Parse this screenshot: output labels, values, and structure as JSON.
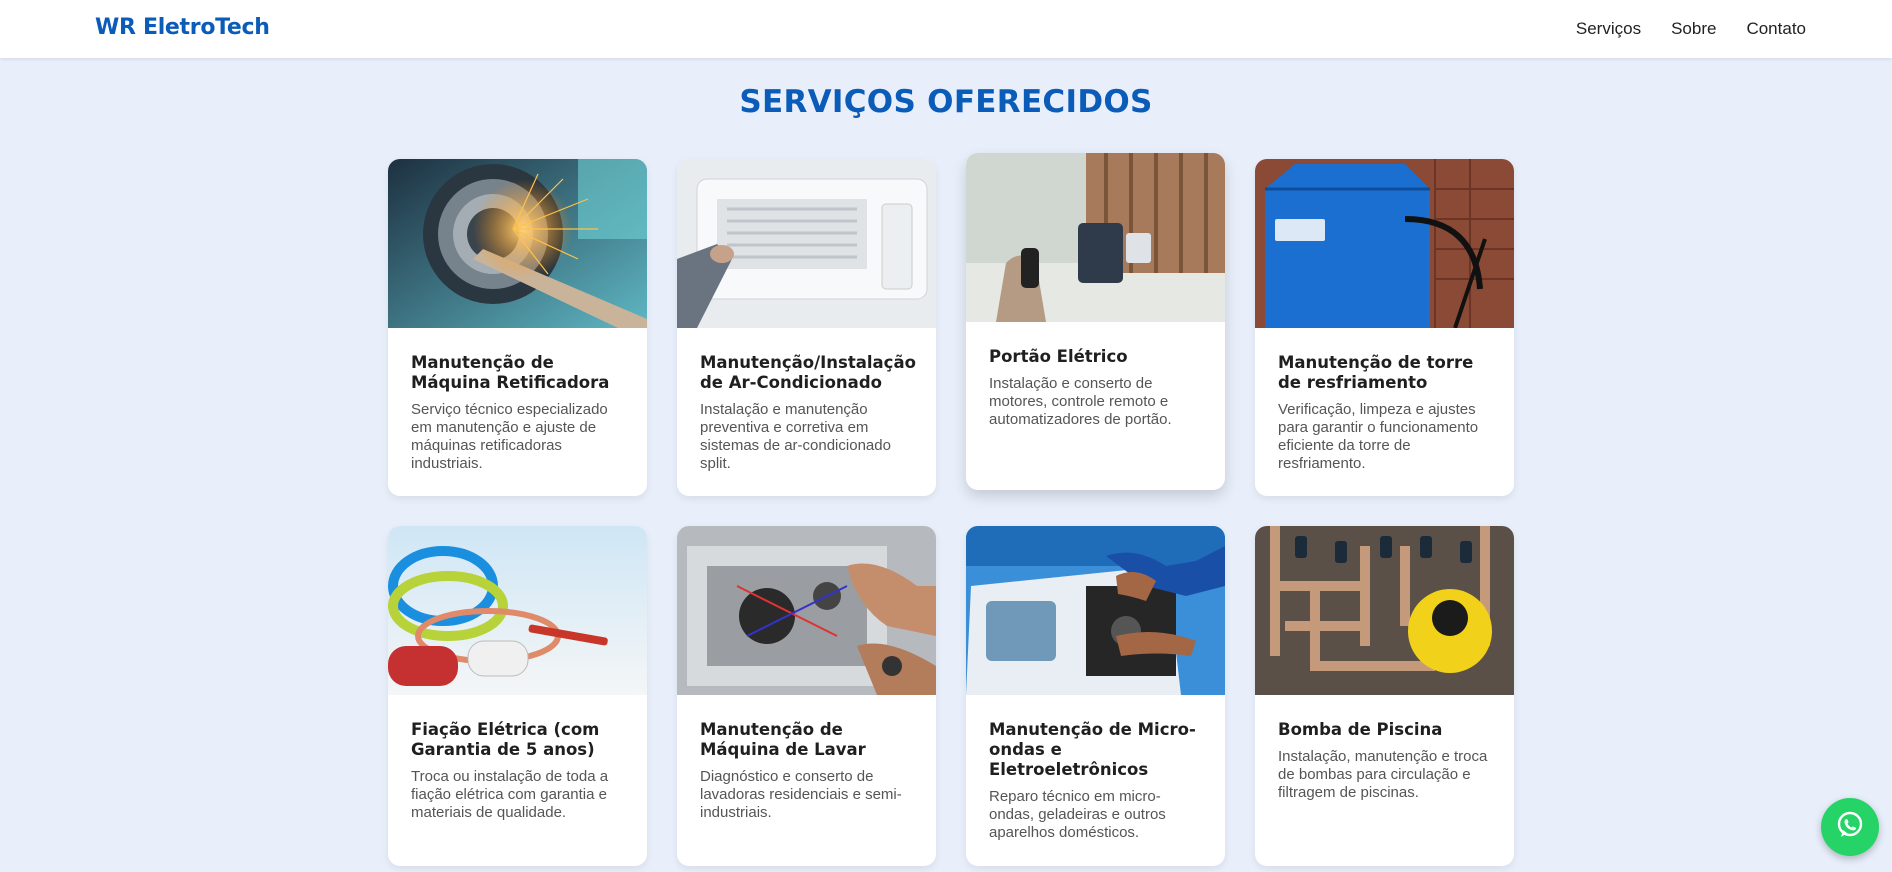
{
  "nav": {
    "logo": "WR EletroTech",
    "links": [
      "Serviços",
      "Sobre",
      "Contato"
    ]
  },
  "section": {
    "title": "SERVIÇOS OFERECIDOS"
  },
  "services": [
    {
      "title": "Manutenção de Máquina Retificadora",
      "description": "Serviço técnico especializado em manutenção e ajuste de máquinas retificadoras industriais."
    },
    {
      "title": "Manutenção/Instalação de Ar-Condicionado",
      "description": "Instalação e manutenção preventiva e corretiva em sistemas de ar-condicionado split."
    },
    {
      "title": "Portão Elétrico",
      "description": "Instalação e conserto de motores, controle remoto e automatizadores de portão."
    },
    {
      "title": "Manutenção de torre de resfriamento",
      "description": "Verificação, limpeza e ajustes para garantir o funcionamento eficiente da torre de resfriamento."
    },
    {
      "title": "Fiação Elétrica (com Garantia de 5 anos)",
      "description": "Troca ou instalação de toda a fiação elétrica com garantia e materiais de qualidade."
    },
    {
      "title": "Manutenção de Máquina de Lavar",
      "description": "Diagnóstico e conserto de lavadoras residenciais e semi-industriais."
    },
    {
      "title": "Manutenção de Micro-ondas e Eletroeletrônicos",
      "description": "Reparo técnico em micro-ondas, geladeiras e outros aparelhos domésticos."
    },
    {
      "title": "Bomba de Piscina",
      "description": "Instalação, manutenção e troca de bombas para circulação e filtragem de piscinas."
    }
  ],
  "whatsapp": {
    "icon": "whatsapp-icon",
    "color": "#25d366"
  },
  "colors": {
    "brand": "#0b5cb8",
    "background": "#e8effb"
  }
}
